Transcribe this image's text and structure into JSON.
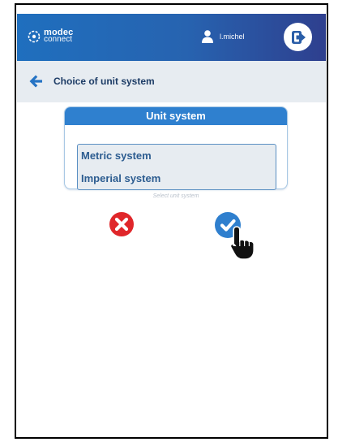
{
  "header": {
    "logo_line1": "modec",
    "logo_line2": "connect",
    "username": "l.michel",
    "logout_icon": "logout-icon",
    "colors": {
      "bar_start": "#1f6fbe",
      "bar_end": "#2e3f8e"
    }
  },
  "subheader": {
    "title": "Choice of unit system",
    "back_icon": "arrow-left-icon"
  },
  "panel": {
    "title": "Unit system",
    "options": [
      "Metric system",
      "Imperial system"
    ],
    "hint": "Select unit system"
  },
  "actions": {
    "cancel_icon": "cancel-icon",
    "confirm_icon": "confirm-check-icon",
    "colors": {
      "cancel": "#e0262a",
      "confirm": "#2f7fce"
    }
  },
  "cursor": {
    "icon": "hand-pointer-icon"
  }
}
